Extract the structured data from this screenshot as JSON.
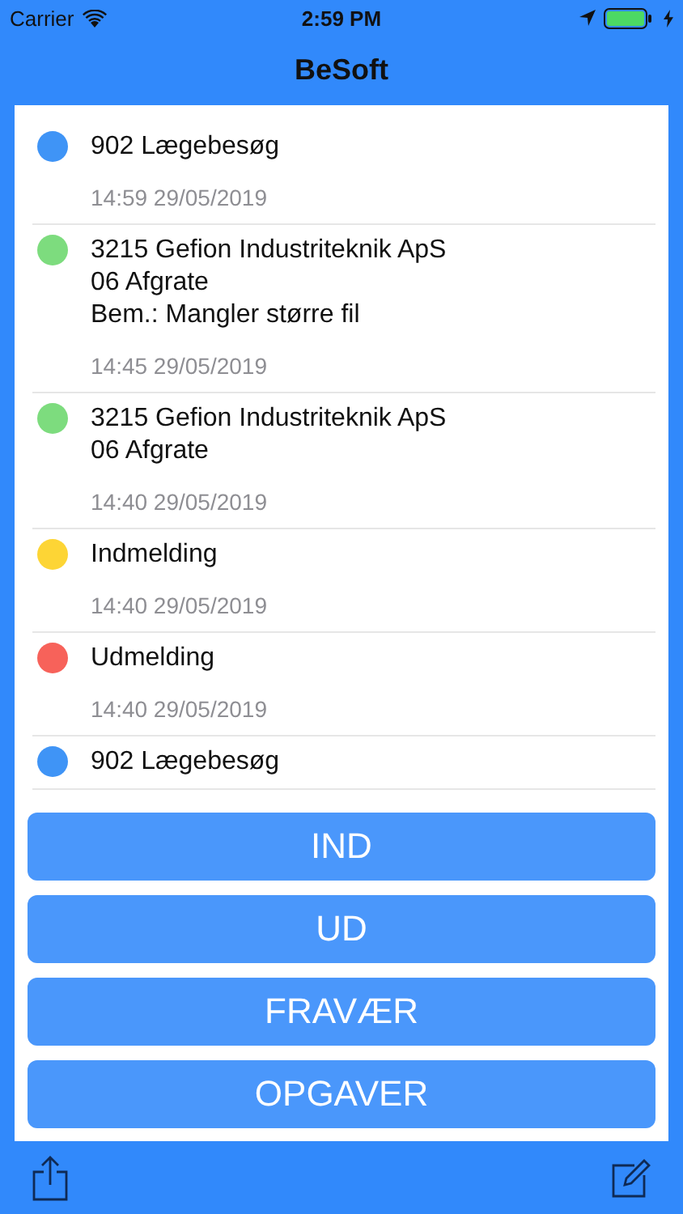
{
  "status_bar": {
    "carrier": "Carrier",
    "time": "2:59 PM"
  },
  "nav": {
    "title": "BeSoft"
  },
  "entries": [
    {
      "color": "#3f94f6",
      "lines": [
        "902 Lægebesøg"
      ],
      "time": "14:59 29/05/2019"
    },
    {
      "color": "#7ddc7e",
      "lines": [
        "3215 Gefion Industriteknik ApS",
        "06 Afgrate",
        "Bem.: Mangler større fil"
      ],
      "time": "14:45 29/05/2019"
    },
    {
      "color": "#7ddc7e",
      "lines": [
        "3215 Gefion Industriteknik ApS",
        "06 Afgrate"
      ],
      "time": "14:40 29/05/2019"
    },
    {
      "color": "#fdd535",
      "lines": [
        "Indmelding"
      ],
      "time": "14:40 29/05/2019"
    },
    {
      "color": "#f7625a",
      "lines": [
        "Udmelding"
      ],
      "time": "14:40 29/05/2019"
    },
    {
      "color": "#3f94f6",
      "lines": [
        "902 Lægebesøg"
      ]
    }
  ],
  "buttons": [
    "IND",
    "UD",
    "FRAVÆR",
    "OPGAVER"
  ]
}
